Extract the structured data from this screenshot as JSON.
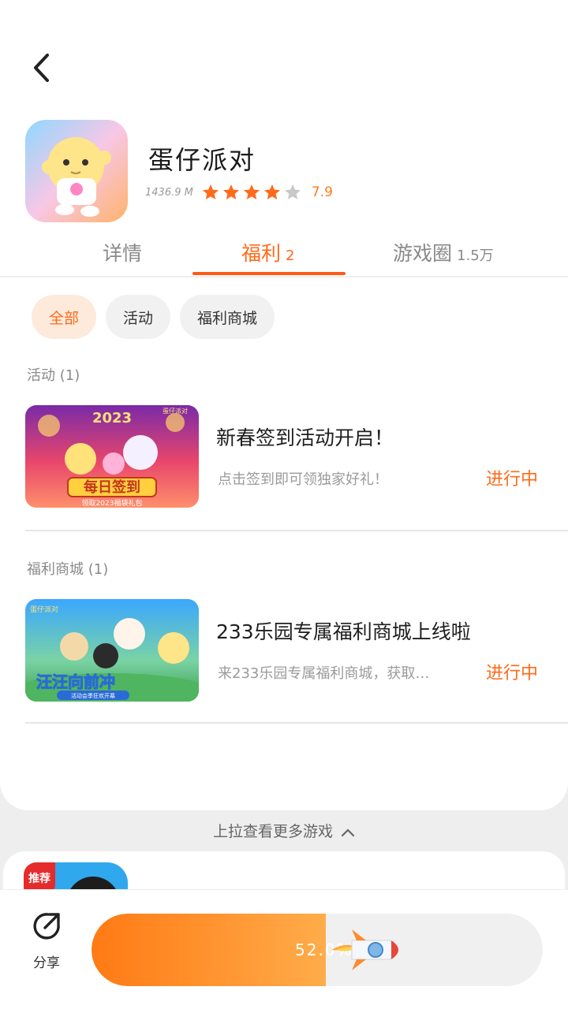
{
  "header": {
    "back_icon": "chevron-left-icon"
  },
  "app": {
    "name": "蛋仔派对",
    "size": "1436.9 M",
    "stars_filled": 4,
    "stars_total": 5,
    "rating": "7.9"
  },
  "tabs": [
    {
      "label": "详情",
      "sub": ""
    },
    {
      "label": "福利",
      "sub": "2"
    },
    {
      "label": "游戏圈",
      "sub": "1.5万"
    }
  ],
  "active_tab": 1,
  "filters": [
    {
      "label": "全部"
    },
    {
      "label": "活动"
    },
    {
      "label": "福利商城"
    }
  ],
  "sections": [
    {
      "title": "活动 (1)",
      "items": [
        {
          "title": "新春签到活动开启！",
          "desc": "点击签到即可领独家好礼！",
          "status": "进行中",
          "thumb_text": "每日签到",
          "thumb_sub": "领取2023福袋礼包",
          "thumb_year": "2023",
          "thumb_brand": "蛋仔派对"
        }
      ]
    },
    {
      "title": "福利商城 (1)",
      "items": [
        {
          "title": "233乐园专属福利商城上线啦",
          "desc": "来233乐园专属福利商城，获取…",
          "status": "进行中",
          "thumb_text": "汪汪向前冲",
          "thumb_sub": "活动会季狂欢开幕",
          "thumb_brand": "蛋仔派对"
        }
      ]
    }
  ],
  "pull_hint": "上拉查看更多游戏",
  "next_game": {
    "badge": "推荐"
  },
  "bottom": {
    "share_label": "分享",
    "download_progress": 0.52,
    "download_text": "52.0%"
  },
  "colors": {
    "accent": "#ff6a1a",
    "chip_active_bg": "#fdeadb",
    "star_empty": "#c8c8c8"
  }
}
